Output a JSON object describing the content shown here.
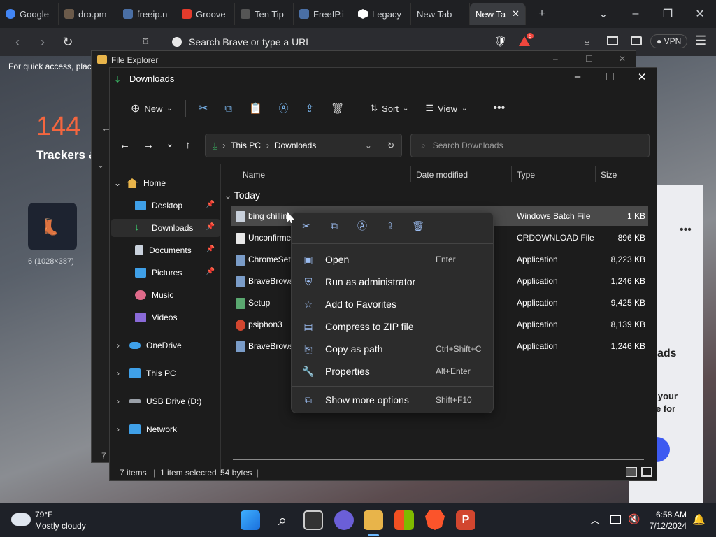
{
  "browser": {
    "tabs": [
      {
        "label": "Google",
        "color": "#4285f4"
      },
      {
        "label": "dro.pm",
        "color": "#6b5a4a"
      },
      {
        "label": "freeip.n",
        "color": "#4a6fa5"
      },
      {
        "label": "Groove",
        "color": "#e43b2c"
      },
      {
        "label": "Ten Tip",
        "color": "#555555"
      },
      {
        "label": "FreeIP.i",
        "color": "#4a6fa5"
      },
      {
        "label": "Legacy",
        "color": "#ffffff"
      },
      {
        "label": "New Tab",
        "color": "#3a3c40"
      },
      {
        "label": "New Ta",
        "color": "#3a3c40"
      }
    ],
    "url_placeholder": "Search Brave or type a URL",
    "vpn_label": "VPN",
    "notification_count": "5"
  },
  "newtab": {
    "quick_access_text": "For quick access, place",
    "tracker_count": "144",
    "trackers_label": "Trackers &",
    "tile_caption": "6 (1028×387)",
    "side_heading": "ads",
    "side_lines": [
      "e your",
      "ge for",
      "."
    ]
  },
  "back_explorer": {
    "title": "File Explorer",
    "page": "7"
  },
  "explorer": {
    "title": "Downloads",
    "toolbar": {
      "new_label": "New",
      "sort_label": "Sort",
      "view_label": "View"
    },
    "breadcrumb": [
      "This PC",
      "Downloads"
    ],
    "search_placeholder": "Search Downloads",
    "nav": [
      {
        "label": "Home"
      },
      {
        "label": "Desktop"
      },
      {
        "label": "Downloads"
      },
      {
        "label": "Documents"
      },
      {
        "label": "Pictures"
      },
      {
        "label": "Music"
      },
      {
        "label": "Videos"
      },
      {
        "label": "OneDrive"
      },
      {
        "label": "This PC"
      },
      {
        "label": "USB Drive (D:)"
      },
      {
        "label": "Network"
      }
    ],
    "columns": [
      "Name",
      "Date modified",
      "Type",
      "Size"
    ],
    "group": "Today",
    "files": [
      {
        "name": "bing chillin",
        "type": "Windows Batch File",
        "size": "1 KB"
      },
      {
        "name": "Unconfirme",
        "type": "CRDOWNLOAD File",
        "size": "896 KB"
      },
      {
        "name": "ChromeSet",
        "type": "Application",
        "size": "8,223 KB"
      },
      {
        "name": "BraveBrows",
        "type": "Application",
        "size": "1,246 KB"
      },
      {
        "name": "Setup",
        "type": "Application",
        "size": "9,425 KB"
      },
      {
        "name": "psiphon3",
        "type": "Application",
        "size": "8,139 KB"
      },
      {
        "name": "BraveBrows",
        "type": "Application",
        "size": "1,246 KB"
      }
    ],
    "status": {
      "items": "7 items",
      "selected": "1 item selected",
      "bytes": "54 bytes"
    }
  },
  "context_menu": {
    "items": [
      {
        "label": "Open",
        "shortcut": "Enter"
      },
      {
        "label": "Run as administrator",
        "shortcut": ""
      },
      {
        "label": "Add to Favorites",
        "shortcut": ""
      },
      {
        "label": "Compress to ZIP file",
        "shortcut": ""
      },
      {
        "label": "Copy as path",
        "shortcut": "Ctrl+Shift+C"
      },
      {
        "label": "Properties",
        "shortcut": "Alt+Enter"
      },
      {
        "label": "Show more options",
        "shortcut": "Shift+F10"
      }
    ]
  },
  "taskbar": {
    "temperature": "79°F",
    "weather": "Mostly cloudy",
    "time": "6:58 AM",
    "date": "7/12/2024"
  }
}
